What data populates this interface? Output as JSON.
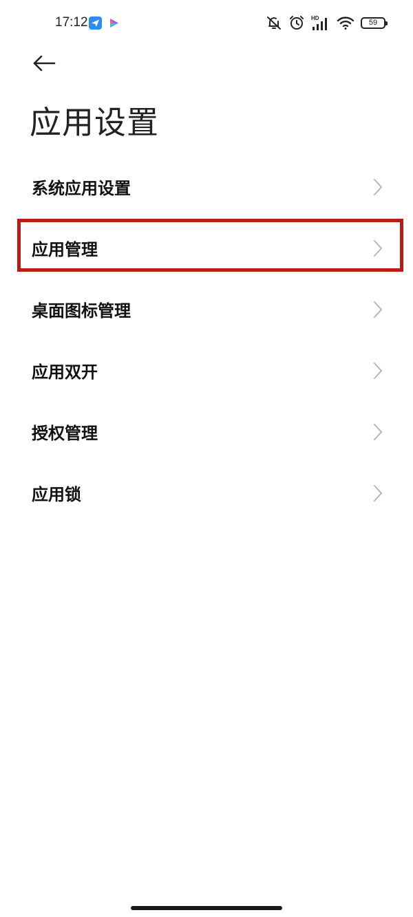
{
  "status_bar": {
    "time": "17:12",
    "battery_level": "59",
    "icons": [
      "send-app-icon",
      "video-app-icon",
      "mute-icon",
      "alarm-icon",
      "hd-signal-icon",
      "wifi-icon",
      "battery-icon"
    ],
    "signal_label": "HD"
  },
  "header": {
    "back_icon": "arrow-left-icon",
    "title": "应用设置"
  },
  "settings": {
    "items": [
      {
        "label": "系统应用设置"
      },
      {
        "label": "应用管理"
      },
      {
        "label": "桌面图标管理"
      },
      {
        "label": "应用双开"
      },
      {
        "label": "授权管理"
      },
      {
        "label": "应用锁"
      }
    ]
  },
  "colors": {
    "highlight": "#b81c12",
    "text": "#111111",
    "chevron": "#b5b5b5",
    "app_icon_blue": "#2d8cf0"
  }
}
